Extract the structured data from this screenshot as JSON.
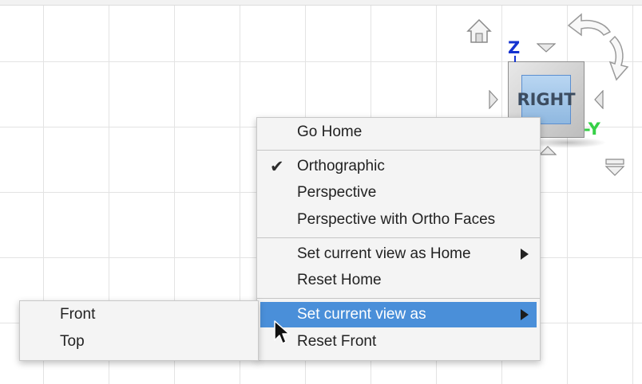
{
  "viewcube": {
    "face_label": "RIGHT",
    "axis_z": "Z",
    "axis_y": "-Y"
  },
  "icons": [
    "home-icon",
    "rotate-arrow-icon",
    "triangle-arrow-icon",
    "cursor-arrow-icon",
    "checkmark-icon",
    "submenu-arrow-icon"
  ],
  "context_menu": {
    "go_home": "Go Home",
    "orthographic": "Orthographic",
    "perspective": "Perspective",
    "perspective_ortho_faces": "Perspective with Ortho Faces",
    "set_current_view_as_home": "Set current view as Home",
    "reset_home": "Reset Home",
    "set_current_view_as": "Set current view as",
    "reset_front": "Reset Front",
    "checked_item": "Orthographic",
    "highlighted_item": "Set current view as"
  },
  "submenu": {
    "items": [
      "Front",
      "Top"
    ]
  },
  "colors": {
    "highlight": "#4a8fd9",
    "axis_z": "#1533d0",
    "axis_y": "#36d047",
    "cube_face": "#a6c8ea"
  }
}
